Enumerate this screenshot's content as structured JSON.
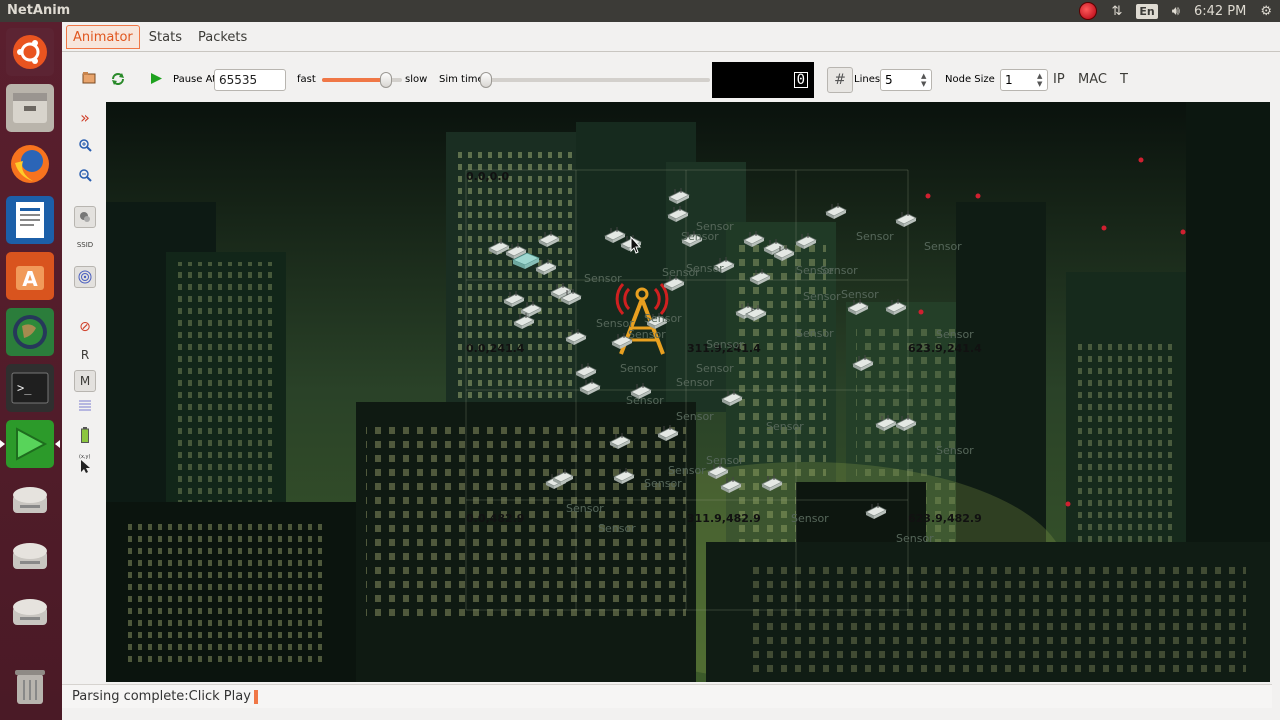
{
  "window": {
    "title": "NetAnim"
  },
  "system_tray": {
    "lang": "En",
    "time": "6:42 PM"
  },
  "launcher": {
    "items": [
      {
        "name": "ubuntu-logo-icon"
      },
      {
        "name": "files-icon"
      },
      {
        "name": "firefox-icon"
      },
      {
        "name": "writer-icon"
      },
      {
        "name": "software-center-icon"
      },
      {
        "name": "globe-icon"
      },
      {
        "name": "terminal-icon"
      },
      {
        "name": "netanim-icon"
      },
      {
        "name": "drive-icon"
      },
      {
        "name": "drive-icon"
      },
      {
        "name": "drive-icon"
      },
      {
        "name": "trash-icon"
      }
    ]
  },
  "tabs": [
    {
      "label": "Animator",
      "selected": true
    },
    {
      "label": "Stats",
      "selected": false
    },
    {
      "label": "Packets",
      "selected": false
    }
  ],
  "toolbar": {
    "pause_at_label": "Pause At",
    "pause_at_value": "65535",
    "fast_label": "fast",
    "slow_label": "slow",
    "speed_fraction": 0.86,
    "sim_time_label": "Sim time",
    "sim_time_fraction": 0.0,
    "time_display": "0",
    "lines_label": "Lines",
    "lines_value": "5",
    "node_size_label": "Node Size",
    "node_size_value": "1",
    "ip_label": "IP",
    "mac_label": "MAC",
    "t_label": "T"
  },
  "side_tools": {
    "r_label": "R",
    "m_label": "M"
  },
  "canvas": {
    "coord_labels": [
      "0.0,0.0",
      "0.0,241.4",
      "311.9,241.4",
      "623.9,241.4",
      "0.0,482.9",
      "311.9,482.9",
      "623.9,482.9"
    ],
    "node_label": "Sensor"
  },
  "status": {
    "text": "Parsing complete:Click Play"
  }
}
